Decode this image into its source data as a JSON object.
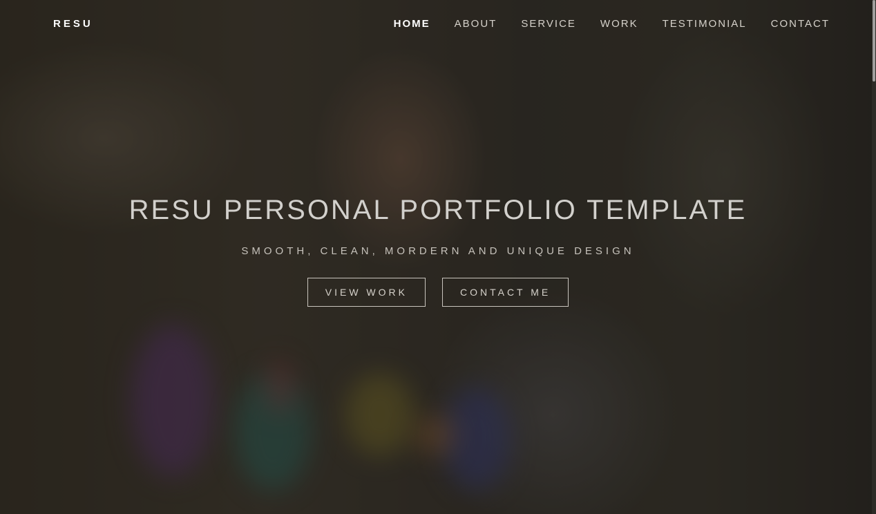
{
  "brand": "RESU",
  "nav": {
    "items": [
      {
        "label": "HOME",
        "active": true
      },
      {
        "label": "ABOUT"
      },
      {
        "label": "SERVICE"
      },
      {
        "label": "WORK"
      },
      {
        "label": "TESTIMONIAL"
      },
      {
        "label": "CONTACT"
      }
    ]
  },
  "hero": {
    "title": "RESU PERSONAL PORTFOLIO TEMPLATE",
    "subtitle": "SMOOTH, CLEAN, MORDERN AND UNIQUE DESIGN",
    "buttons": {
      "view_work": "VIEW WORK",
      "contact_me": "CONTACT ME"
    }
  },
  "colors": {
    "text": "#ffffff",
    "nav_text": "#d6d2cb",
    "overlay": "rgba(20,18,16,0.45)"
  }
}
